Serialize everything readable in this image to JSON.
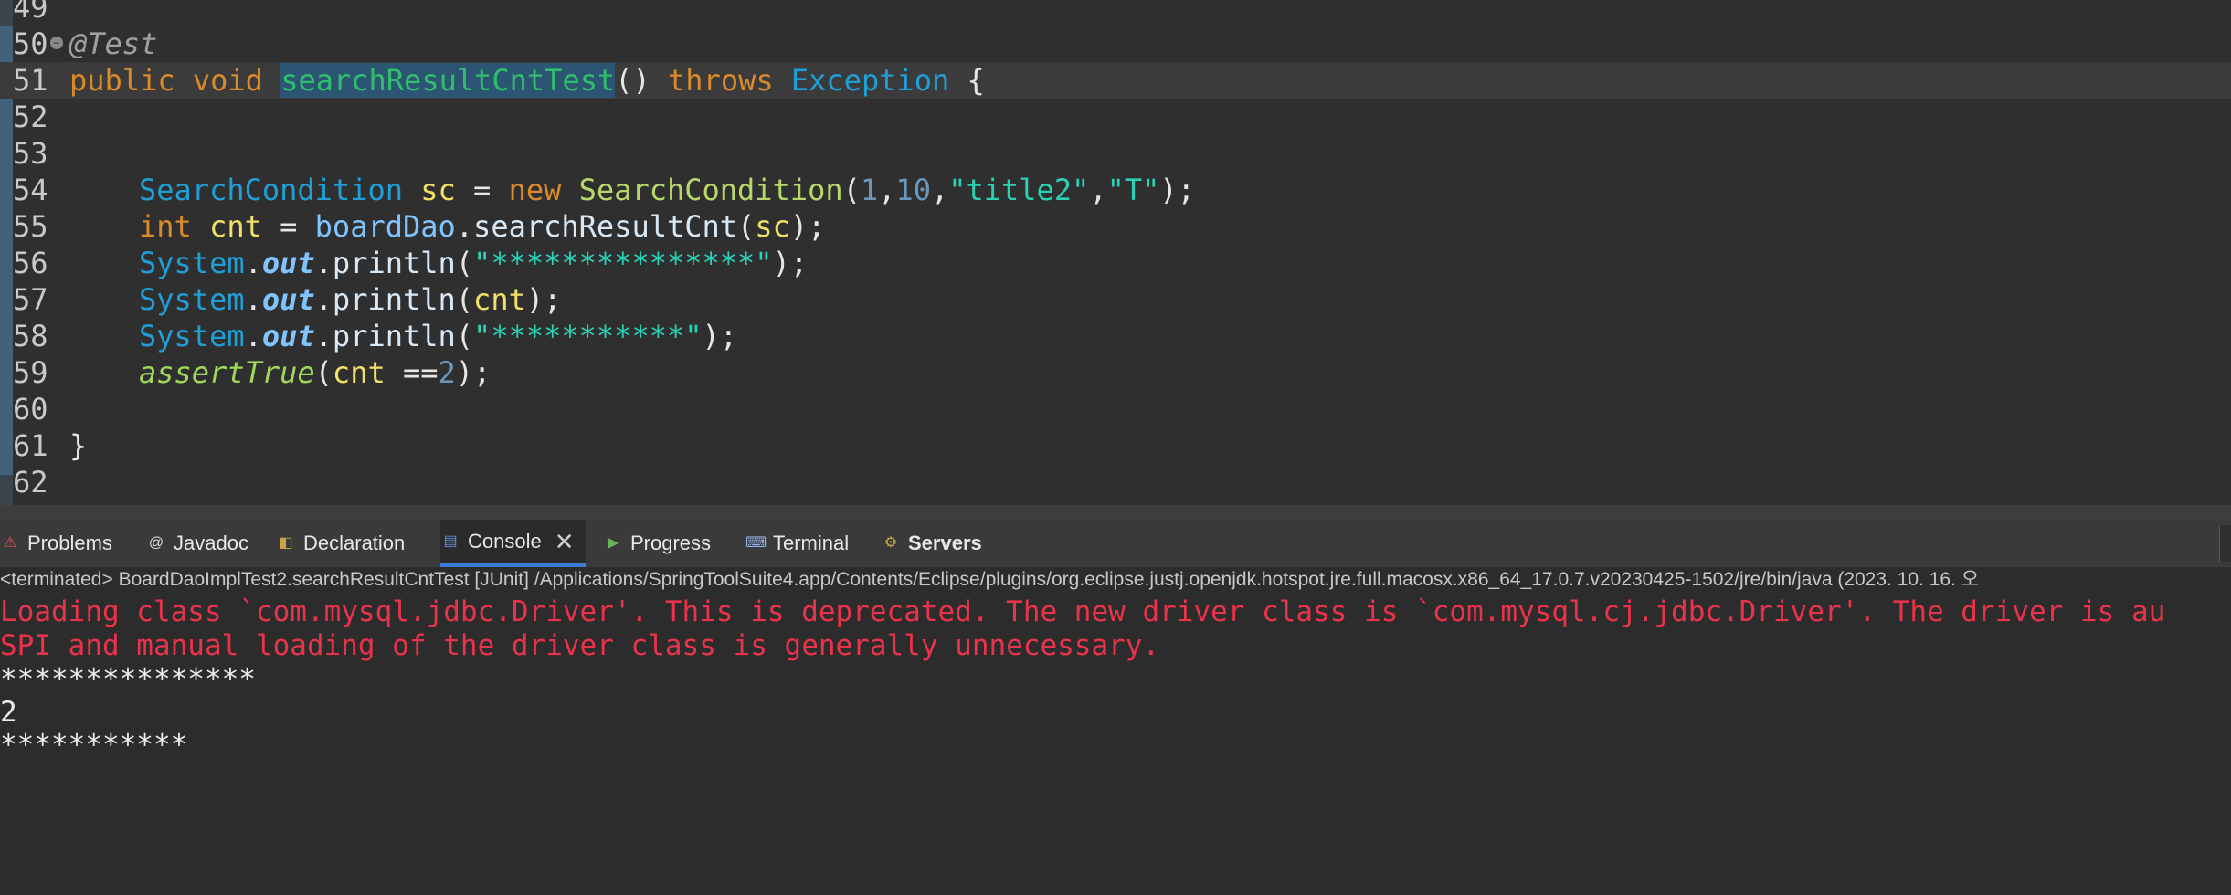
{
  "editor": {
    "lines": [
      {
        "num": "49",
        "tokens": []
      },
      {
        "num": "50",
        "fold": true,
        "tokens": [
          [
            "ann",
            "@Test"
          ]
        ]
      },
      {
        "num": "51",
        "current": true,
        "tokens": [
          [
            "kw",
            "public"
          ],
          [
            "plain",
            " "
          ],
          [
            "kw",
            "void"
          ],
          [
            "plain",
            " "
          ],
          [
            "sel",
            "searchResultCntTest"
          ],
          [
            "plain",
            "() "
          ],
          [
            "kw",
            "throws"
          ],
          [
            "plain",
            " "
          ],
          [
            "ty",
            "Exception"
          ],
          [
            "plain",
            " {"
          ]
        ]
      },
      {
        "num": "52",
        "tokens": []
      },
      {
        "num": "53",
        "tokens": []
      },
      {
        "num": "54",
        "tokens": [
          [
            "cls",
            "SearchCondition"
          ],
          [
            "plain",
            " "
          ],
          [
            "var",
            "sc"
          ],
          [
            "plain",
            " = "
          ],
          [
            "kw",
            "new"
          ],
          [
            "plain",
            " "
          ],
          [
            "ctor",
            "SearchCondition"
          ],
          [
            "plain",
            "("
          ],
          [
            "num",
            "1"
          ],
          [
            "plain",
            ","
          ],
          [
            "num",
            "10"
          ],
          [
            "plain",
            ","
          ],
          [
            "str",
            "\"title2\""
          ],
          [
            "plain",
            ","
          ],
          [
            "str",
            "\"T\""
          ],
          [
            "plain",
            ");"
          ]
        ]
      },
      {
        "num": "55",
        "tokens": [
          [
            "kw",
            "int"
          ],
          [
            "plain",
            " "
          ],
          [
            "var",
            "cnt"
          ],
          [
            "plain",
            " = "
          ],
          [
            "obj",
            "boardDao"
          ],
          [
            "plain",
            "."
          ],
          [
            "mth",
            "searchResultCnt"
          ],
          [
            "plain",
            "("
          ],
          [
            "var",
            "sc"
          ],
          [
            "plain",
            ");"
          ]
        ]
      },
      {
        "num": "56",
        "tokens": [
          [
            "cls",
            "System"
          ],
          [
            "plain",
            "."
          ],
          [
            "fld",
            "out"
          ],
          [
            "plain",
            "."
          ],
          [
            "mth",
            "println"
          ],
          [
            "plain",
            "("
          ],
          [
            "str",
            "\"***************\""
          ],
          [
            "plain",
            ");"
          ]
        ]
      },
      {
        "num": "57",
        "tokens": [
          [
            "cls",
            "System"
          ],
          [
            "plain",
            "."
          ],
          [
            "fld",
            "out"
          ],
          [
            "plain",
            "."
          ],
          [
            "mth",
            "println"
          ],
          [
            "plain",
            "("
          ],
          [
            "var",
            "cnt"
          ],
          [
            "plain",
            ");"
          ]
        ]
      },
      {
        "num": "58",
        "tokens": [
          [
            "cls",
            "System"
          ],
          [
            "plain",
            "."
          ],
          [
            "fld",
            "out"
          ],
          [
            "plain",
            "."
          ],
          [
            "mth",
            "println"
          ],
          [
            "plain",
            "("
          ],
          [
            "str",
            "\"***********\""
          ],
          [
            "plain",
            ");"
          ]
        ]
      },
      {
        "num": "59",
        "tokens": [
          [
            "stat",
            "assertTrue"
          ],
          [
            "plain",
            "("
          ],
          [
            "var",
            "cnt"
          ],
          [
            "plain",
            " =="
          ],
          [
            "num",
            "2"
          ],
          [
            "plain",
            ");"
          ]
        ]
      },
      {
        "num": "60",
        "tokens": []
      },
      {
        "num": "61",
        "tokens": [
          [
            "plain",
            "}"
          ]
        ]
      },
      {
        "num": "62",
        "tokens": []
      }
    ]
  },
  "tabs": [
    {
      "label": "Problems",
      "icon": "problems-icon",
      "glyph": "⚠"
    },
    {
      "label": "Javadoc",
      "icon": "javadoc-icon",
      "glyph": "@"
    },
    {
      "label": "Declaration",
      "icon": "declaration-icon",
      "glyph": "◧"
    },
    {
      "label": "Console",
      "icon": "console-icon",
      "glyph": "▤",
      "active": true,
      "close": "✕"
    },
    {
      "label": "Progress",
      "icon": "progress-icon",
      "glyph": "▶"
    },
    {
      "label": "Terminal",
      "icon": "terminal-icon",
      "glyph": "⌨"
    },
    {
      "label": "Servers",
      "icon": "servers-icon",
      "glyph": "⚙",
      "bold": true
    }
  ],
  "console": {
    "status": "<terminated> BoardDaoImplTest2.searchResultCntTest [JUnit] /Applications/SpringToolSuite4.app/Contents/Eclipse/plugins/org.eclipse.justj.openjdk.hotspot.jre.full.macosx.x86_64_17.0.7.v20230425-1502/jre/bin/java  (2023. 10. 16. 오",
    "output": [
      {
        "kind": "err",
        "text": "Loading class `com.mysql.jdbc.Driver'. This is deprecated. The new driver class is `com.mysql.cj.jdbc.Driver'. The driver is au"
      },
      {
        "kind": "err",
        "text": "SPI and manual loading of the driver class is generally unnecessary."
      },
      {
        "kind": "std",
        "text": "***************"
      },
      {
        "kind": "std",
        "text": "2"
      },
      {
        "kind": "std",
        "text": "***********"
      }
    ]
  },
  "colors": {
    "accent": "#3d7bd6",
    "error_text": "#e8334a",
    "selection": "#2c5574"
  }
}
